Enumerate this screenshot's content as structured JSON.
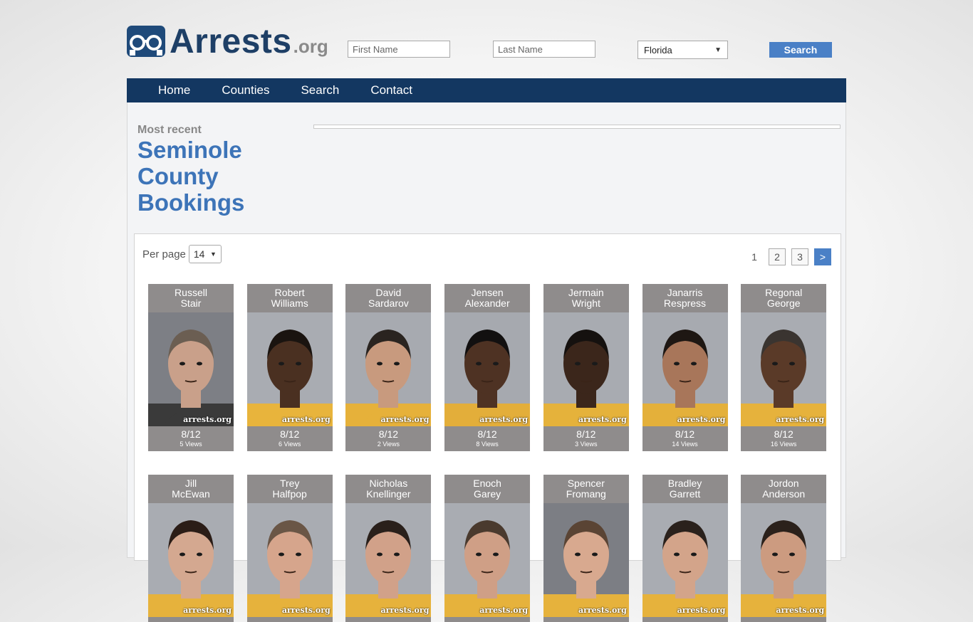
{
  "header": {
    "logo_main": "Arrests",
    "logo_tld": ".org",
    "first_name_placeholder": "First Name",
    "last_name_placeholder": "Last Name",
    "state_selected": "Florida",
    "search_label": "Search"
  },
  "nav": {
    "items": [
      "Home",
      "Counties",
      "Search",
      "Contact"
    ]
  },
  "page": {
    "most_recent": "Most recent",
    "title_line1": "Seminole",
    "title_line2": "County",
    "title_line3": "Bookings"
  },
  "listing": {
    "per_page_label": "Per page",
    "per_page_value": "14",
    "pages": [
      "1",
      "2",
      "3",
      ">"
    ],
    "watermark": "arrests.org",
    "cards": [
      {
        "first": "Russell",
        "last": "Stair",
        "date": "8/12",
        "views": "5 Views",
        "skin": "#c9a08a",
        "hair": "#6b5e52",
        "shirt": "#3a3a3a",
        "bg": "#7d7f85"
      },
      {
        "first": "Robert",
        "last": "Williams",
        "date": "8/12",
        "views": "6 Views",
        "skin": "#4a3021",
        "hair": "#1a1410",
        "shirt": "#e8b43c",
        "bg": "#a9acb2"
      },
      {
        "first": "David",
        "last": "Sardarov",
        "date": "8/12",
        "views": "2 Views",
        "skin": "#c89a7e",
        "hair": "#2a2420",
        "shirt": "#e6b13a",
        "bg": "#a7aab0"
      },
      {
        "first": "Jensen",
        "last": "Alexander",
        "date": "8/12",
        "views": "8 Views",
        "skin": "#4e3223",
        "hair": "#121010",
        "shirt": "#e3ae3a",
        "bg": "#a6a9af"
      },
      {
        "first": "Jermain",
        "last": "Wright",
        "date": "8/12",
        "views": "3 Views",
        "skin": "#3b261b",
        "hair": "#15110f",
        "shirt": "#e5b23b",
        "bg": "#a8abb1"
      },
      {
        "first": "Janarris",
        "last": "Respress",
        "date": "8/12",
        "views": "14 Views",
        "skin": "#a8765a",
        "hair": "#1e1713",
        "shirt": "#e4b03a",
        "bg": "#a7aab0"
      },
      {
        "first": "Regonal",
        "last": "George",
        "date": "8/12",
        "views": "16 Views",
        "skin": "#5a3a28",
        "hair": "#3a3430",
        "shirt": "#e6b23c",
        "bg": "#a9acb2"
      },
      {
        "first": "Jill",
        "last": "McEwan",
        "date": "",
        "views": "",
        "skin": "#d4a890",
        "hair": "#2b1d17",
        "shirt": "#e6b23c",
        "bg": "#a9acb2"
      },
      {
        "first": "Trey",
        "last": "Halfpop",
        "date": "",
        "views": "",
        "skin": "#d6a58c",
        "hair": "#6a5646",
        "shirt": "#e6b23c",
        "bg": "#a9acb2"
      },
      {
        "first": "Nicholas",
        "last": "Knellinger",
        "date": "",
        "views": "",
        "skin": "#d1a189",
        "hair": "#2a201b",
        "shirt": "#e6b23c",
        "bg": "#a9acb2"
      },
      {
        "first": "Enoch",
        "last": "Garey",
        "date": "",
        "views": "",
        "skin": "#cf9f86",
        "hair": "#4a3a2e",
        "shirt": "#e6b23c",
        "bg": "#a9acb2"
      },
      {
        "first": "Spencer",
        "last": "Fromang",
        "date": "",
        "views": "",
        "skin": "#d8a98f",
        "hair": "#5a4434",
        "shirt": "#e6b23c",
        "bg": "#7c7e84"
      },
      {
        "first": "Bradley",
        "last": "Garrett",
        "date": "",
        "views": "",
        "skin": "#d3a48a",
        "hair": "#2a211c",
        "shirt": "#e6b23c",
        "bg": "#a9acb2"
      },
      {
        "first": "Jordon",
        "last": "Anderson",
        "date": "",
        "views": "",
        "skin": "#cc9b80",
        "hair": "#2b211b",
        "shirt": "#e6b23c",
        "bg": "#a9acb2"
      }
    ]
  }
}
